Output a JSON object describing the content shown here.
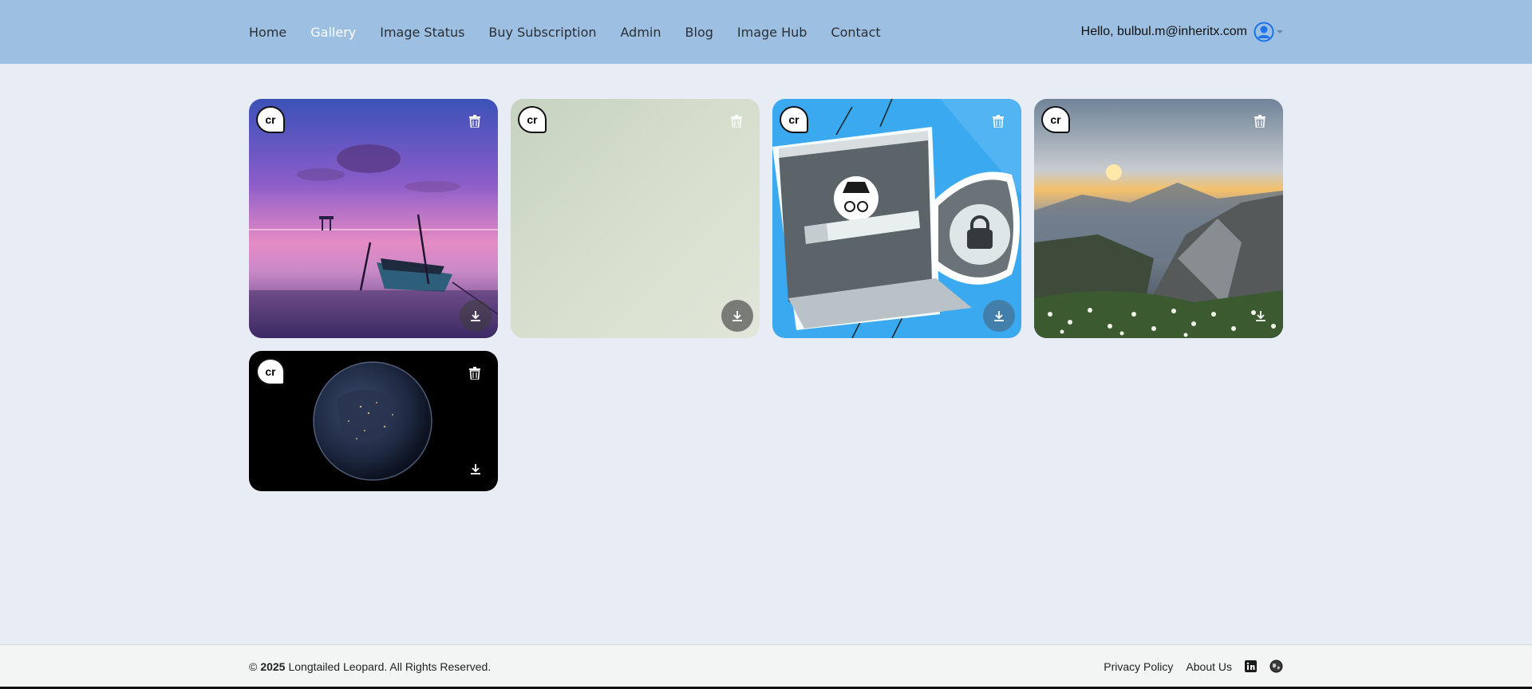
{
  "nav": {
    "items": [
      {
        "label": "Home",
        "active": false
      },
      {
        "label": "Gallery",
        "active": true
      },
      {
        "label": "Image Status",
        "active": false
      },
      {
        "label": "Buy Subscription",
        "active": false
      },
      {
        "label": "Admin",
        "active": false
      },
      {
        "label": "Blog",
        "active": false
      },
      {
        "label": "Image Hub",
        "active": false
      },
      {
        "label": "Contact",
        "active": false
      }
    ],
    "greeting": "Hello, bulbul.m@inheritx.com",
    "user_icon": "user-circle-icon"
  },
  "gallery": {
    "badge_label": "cr",
    "cards": [
      {
        "subject": "sunset-boat",
        "delete_icon": "trash-icon",
        "download_icon": "download-icon"
      },
      {
        "subject": "plain-texture",
        "delete_icon": "trash-icon",
        "download_icon": "download-icon"
      },
      {
        "subject": "vpn-laptop-lock",
        "delete_icon": "trash-icon",
        "download_icon": "download-icon"
      },
      {
        "subject": "mountain-sunset",
        "delete_icon": "trash-icon",
        "download_icon": "download-icon"
      },
      {
        "subject": "earth-night",
        "delete_icon": "trash-icon",
        "download_icon": "download-icon"
      }
    ]
  },
  "footer": {
    "copyright_symbol": "©",
    "year": "2025",
    "company": "Longtailed Leopard. All Rights Reserved.",
    "links": [
      "Privacy Policy",
      "About Us"
    ],
    "icons": [
      "linkedin-icon",
      "globe-icon"
    ]
  },
  "colors": {
    "header_bg": "#9dbfe1",
    "page_bg": "#e8edf5",
    "footer_bg": "#f3f4f4",
    "active_nav": "#ffffff",
    "user_icon": "#1e74e8"
  }
}
